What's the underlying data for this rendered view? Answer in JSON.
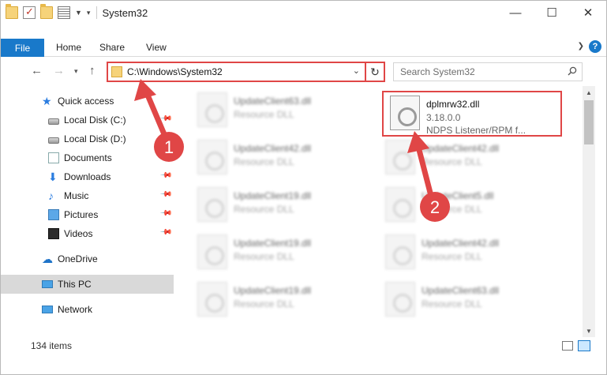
{
  "window": {
    "title": "System32",
    "controls": {
      "minimize": "—",
      "maximize": "☐",
      "close": "✕"
    }
  },
  "ribbon": {
    "tabs": [
      "File",
      "Home",
      "Share",
      "View"
    ],
    "help": "?"
  },
  "address": {
    "path": "C:\\Windows\\System32",
    "search_placeholder": "Search System32"
  },
  "nav": {
    "quick_access": "Quick access",
    "items": [
      "Local Disk (C:)",
      "Local Disk (D:)",
      "Documents",
      "Downloads",
      "Music",
      "Pictures",
      "Videos"
    ],
    "onedrive": "OneDrive",
    "this_pc": "This PC",
    "network": "Network"
  },
  "files": {
    "highlighted": {
      "name": "dplmrw32.dll",
      "version": "3.18.0.0",
      "description": "NDPS Listener/RPM f..."
    },
    "left_column": [
      {
        "name": "UpdateClient63.dll",
        "type": "Resource DLL"
      },
      {
        "name": "UpdateClient42.dll",
        "type": "Resource DLL"
      },
      {
        "name": "UpdateClient19.dll",
        "type": "Resource DLL"
      },
      {
        "name": "UpdateClient19.dll",
        "type": "Resource DLL"
      },
      {
        "name": "UpdateClient19.dll",
        "type": "Resource DLL"
      }
    ],
    "right_column": [
      {
        "name": "UpdateClient42.dll",
        "type": "Resource DLL"
      },
      {
        "name": "UpdateClient5.dll",
        "type": "Resource DLL"
      },
      {
        "name": "UpdateClient42.dll",
        "type": "Resource DLL"
      },
      {
        "name": "UpdateClient63.dll",
        "type": "Resource DLL"
      }
    ]
  },
  "status": {
    "item_count": "134 items"
  },
  "annotations": {
    "step1": "1",
    "step2": "2"
  },
  "colors": {
    "accent": "#1979ca",
    "highlight": "#e04646",
    "selection": "#cce8ff"
  }
}
